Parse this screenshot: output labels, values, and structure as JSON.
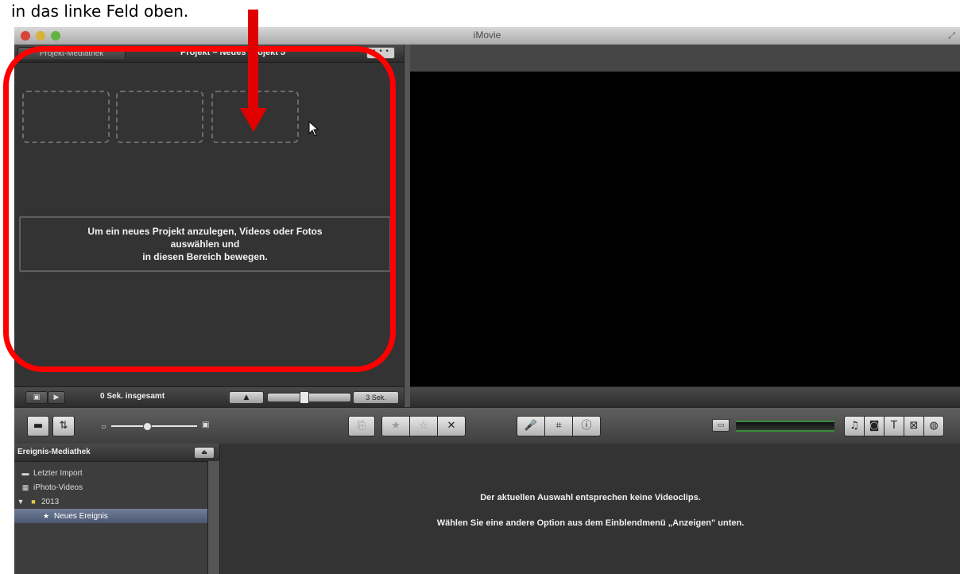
{
  "caption": "in das linke Feld oben.",
  "window": {
    "title": "iMovie"
  },
  "project": {
    "library_button": "Projekt-Mediathek",
    "title": "Projekt – Neues Projekt 5",
    "hint_lines": [
      "Um ein neues Projekt anzulegen, Videos oder Fotos",
      "auswählen und",
      "in diesen Bereich bewegen."
    ],
    "total_duration": "0 Sek. insgesamt",
    "clip_duration": "3 Sek."
  },
  "event_library": {
    "header": "Ereignis-Mediathek",
    "items": [
      {
        "label": "Letzter Import",
        "icon": "film-icon"
      },
      {
        "label": "iPhoto-Videos",
        "icon": "iphoto-icon"
      },
      {
        "label": "2013",
        "icon": "folder-icon"
      },
      {
        "label": "Neues Ereignis",
        "icon": "star-icon"
      }
    ],
    "empty_message_1": "Der aktuellen Auswahl entsprechen keine Videoclips.",
    "empty_message_2": "Wählen Sie eine andere Option aus dem Einblendmenü „Anzeigen\" unten."
  },
  "colors": {
    "annotation_red": "#ff0000",
    "panel_dark": "#333333",
    "viewer_black": "#000000"
  }
}
